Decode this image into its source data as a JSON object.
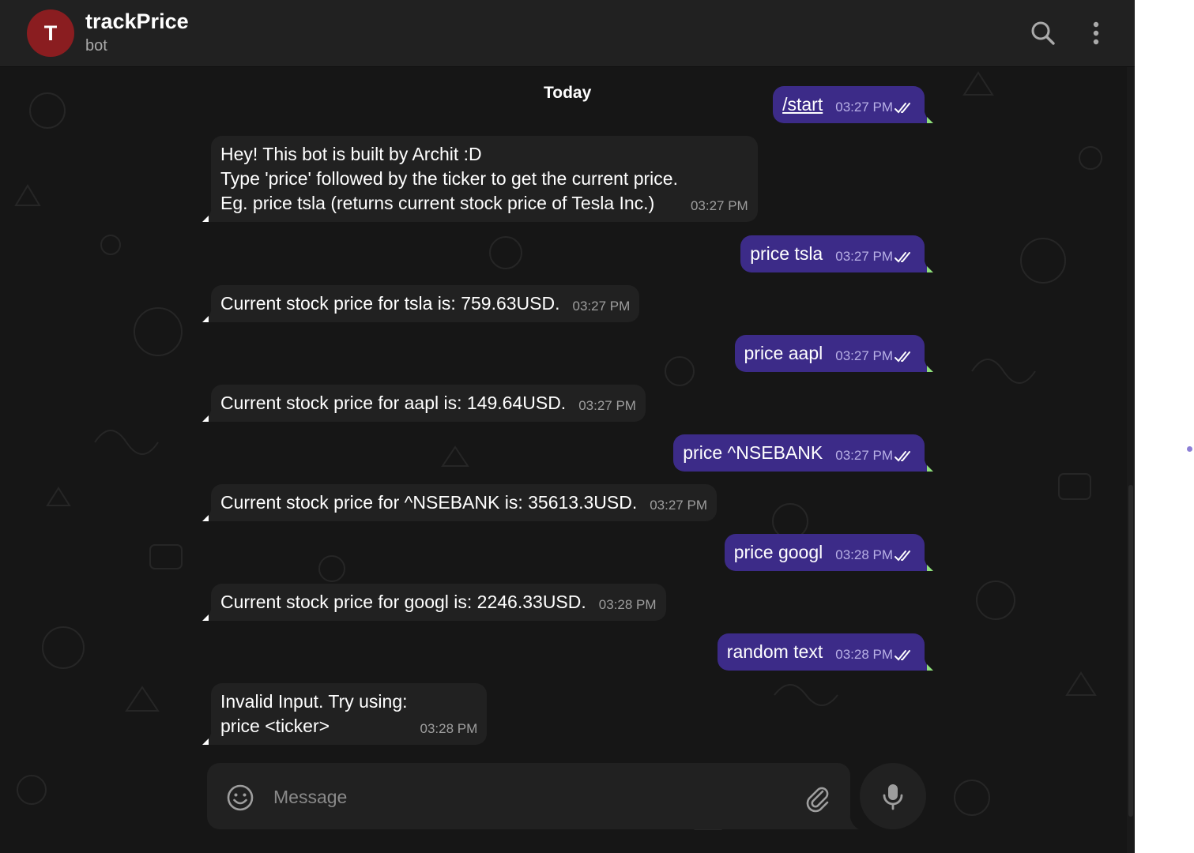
{
  "header": {
    "avatar_letter": "T",
    "title": "trackPrice",
    "status": "bot",
    "icons": [
      "search-icon",
      "more-vertical-icon"
    ]
  },
  "date_chip": "Today",
  "messages": [
    {
      "dir": "out",
      "text": "/start",
      "time": "03:27 PM",
      "read": true,
      "command": true
    },
    {
      "dir": "in",
      "lines": [
        "Hey! This bot is built by Archit :D",
        "Type 'price' followed by the ticker to get the current price.",
        "Eg. price tsla (returns current stock price of Tesla Inc.)"
      ],
      "time": "03:27 PM"
    },
    {
      "dir": "out",
      "text": "price tsla",
      "time": "03:27 PM",
      "read": true
    },
    {
      "dir": "in",
      "lines": [
        "Current stock price for tsla is: 759.63USD."
      ],
      "time": "03:27 PM"
    },
    {
      "dir": "out",
      "text": "price aapl",
      "time": "03:27 PM",
      "read": true
    },
    {
      "dir": "in",
      "lines": [
        "Current stock price for aapl is: 149.64USD."
      ],
      "time": "03:27 PM"
    },
    {
      "dir": "out",
      "text": "price ^NSEBANK",
      "time": "03:27 PM",
      "read": true
    },
    {
      "dir": "in",
      "lines": [
        "Current stock price for ^NSEBANK is: 35613.3USD."
      ],
      "time": "03:27 PM"
    },
    {
      "dir": "out",
      "text": "price googl",
      "time": "03:28 PM",
      "read": true
    },
    {
      "dir": "in",
      "lines": [
        "Current stock price for googl is: 2246.33USD."
      ],
      "time": "03:28 PM"
    },
    {
      "dir": "out",
      "text": "random text",
      "time": "03:28 PM",
      "read": true
    },
    {
      "dir": "in",
      "lines": [
        "Invalid Input. Try using:",
        "price <ticker>"
      ],
      "time": "03:28 PM"
    }
  ],
  "composer": {
    "placeholder": "Message",
    "icons": [
      "smile-icon",
      "paperclip-icon",
      "microphone-icon"
    ]
  },
  "colors": {
    "background": "#161616",
    "header": "#212121",
    "incoming_bubble": "#212121",
    "outgoing_bubble": "#3c2b88",
    "avatar": "#8a1d20",
    "check_green": "#8fe07c"
  }
}
